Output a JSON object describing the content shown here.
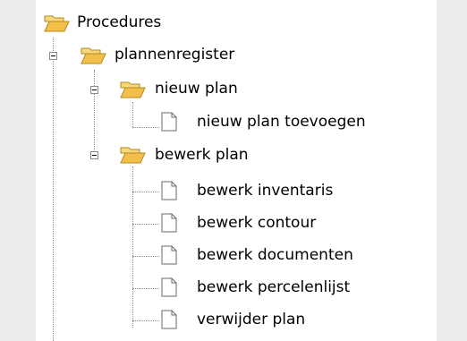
{
  "tree": {
    "root": {
      "label": "Procedures",
      "icon": "folder-open-icon"
    },
    "plannenregister": {
      "label": "plannenregister",
      "icon": "folder-open-icon"
    },
    "nieuw_plan": {
      "label": "nieuw plan",
      "icon": "folder-open-icon",
      "items": [
        {
          "label": "nieuw plan toevoegen",
          "icon": "document-icon"
        }
      ]
    },
    "bewerk_plan": {
      "label": "bewerk plan",
      "icon": "folder-open-icon",
      "items": [
        {
          "label": "bewerk inventaris",
          "icon": "document-icon"
        },
        {
          "label": "bewerk contour",
          "icon": "document-icon"
        },
        {
          "label": "bewerk documenten",
          "icon": "document-icon"
        },
        {
          "label": "bewerk percelenlijst",
          "icon": "document-icon"
        },
        {
          "label": "verwijder plan",
          "icon": "document-icon"
        }
      ]
    }
  }
}
